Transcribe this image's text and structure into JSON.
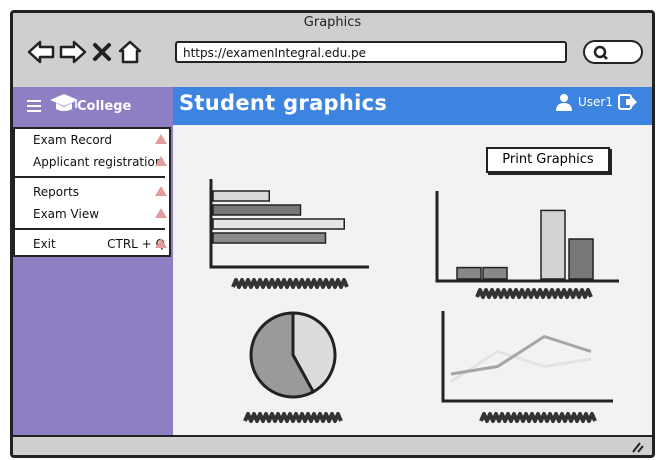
{
  "window": {
    "title": "Graphics"
  },
  "browser": {
    "url": "https://examenIntegral.edu.pe",
    "nav_icons": [
      "back-arrow-icon",
      "forward-arrow-icon",
      "close-x-icon",
      "home-icon"
    ],
    "search_icon": "search-icon"
  },
  "sidebar": {
    "menu_icon": "hamburger-icon",
    "logo_icon": "graduation-cap-icon",
    "brand": "College",
    "background": "#8e7ec4",
    "menu_items": [
      {
        "label": "Exam Record"
      },
      {
        "label": "Applicant registration"
      },
      {
        "label": "Reports"
      },
      {
        "label": "Exam View"
      },
      {
        "label": "Exit",
        "shortcut": "CTRL + Q"
      }
    ]
  },
  "header": {
    "title": "Student graphics",
    "user": "User1",
    "user_icon": "user-icon",
    "logout_icon": "logout-arrow-icon",
    "background": "#3d84e0"
  },
  "main": {
    "print_label": "Print Graphics"
  },
  "chart_data": [
    {
      "type": "bar",
      "orientation": "horizontal",
      "series": [
        {
          "values": [
            4.5,
            7,
            10.5,
            9
          ]
        }
      ],
      "colors": [
        "#d9d9d9",
        "#777777",
        "#e6e6e6",
        "#8a8a8a"
      ],
      "xlabel": "",
      "ylabel": ""
    },
    {
      "type": "bar",
      "orientation": "vertical",
      "values": [
        1,
        1,
        6,
        3.5
      ],
      "colors": [
        "#888888",
        "#888888",
        "#d3d3d3",
        "#777777"
      ],
      "xlabel": "",
      "ylabel": ""
    },
    {
      "type": "pie",
      "values": [
        42,
        58
      ],
      "colors": [
        "#9a9a9a",
        "#dcdcdc"
      ]
    },
    {
      "type": "line",
      "series": [
        {
          "values": [
            2,
            3,
            7,
            5
          ],
          "color": "#a5a5a5"
        },
        {
          "values": [
            1,
            5,
            3,
            4
          ],
          "color": "#e3e3e3"
        }
      ],
      "xlabel": "",
      "ylabel": ""
    }
  ]
}
